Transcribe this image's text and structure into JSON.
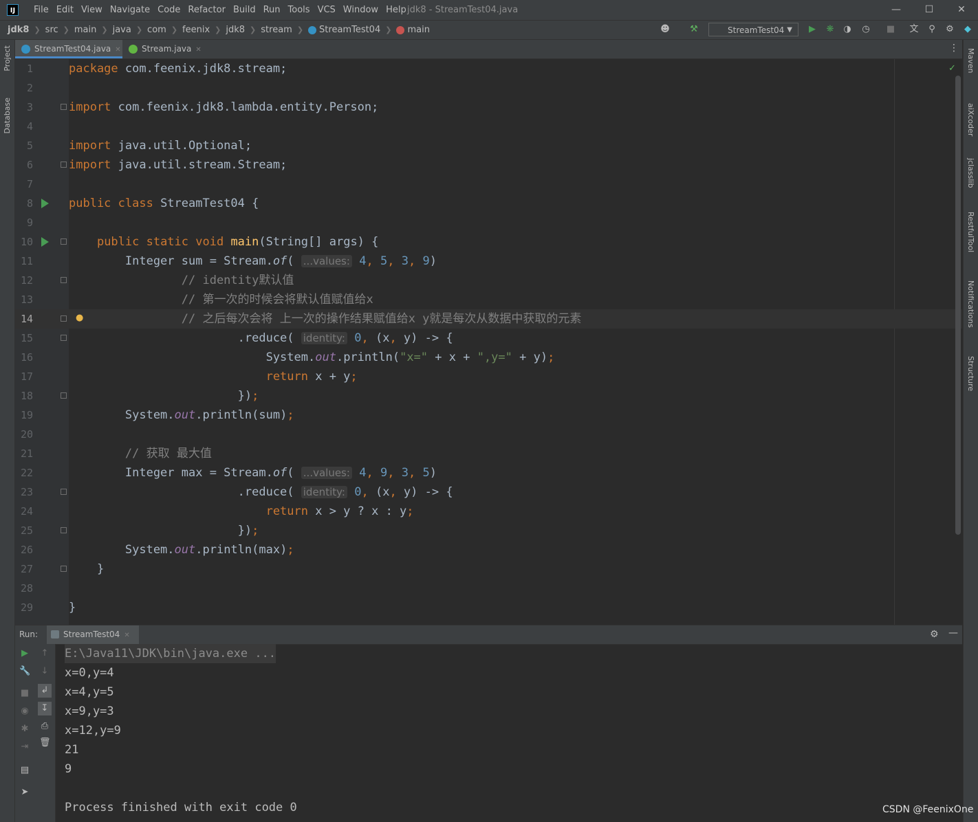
{
  "app": {
    "logo": "IJ",
    "menu": [
      "File",
      "Edit",
      "View",
      "Navigate",
      "Code",
      "Refactor",
      "Build",
      "Run",
      "Tools",
      "VCS",
      "Window",
      "Help"
    ],
    "window_title": "jdk8 - StreamTest04.java",
    "window_controls": [
      "minimize-icon",
      "maximize-icon",
      "close-icon"
    ]
  },
  "breadcrumb": [
    {
      "label": "jdk8",
      "bold": true
    },
    {
      "label": "src"
    },
    {
      "label": "main"
    },
    {
      "label": "java"
    },
    {
      "label": "com"
    },
    {
      "label": "feenix"
    },
    {
      "label": "jdk8"
    },
    {
      "label": "stream"
    },
    {
      "label": "StreamTest04",
      "icon": "class-icon"
    },
    {
      "label": "main",
      "icon": "method-icon"
    }
  ],
  "toolbar": {
    "run_config": "StreamTest04",
    "icons": [
      "user-icon",
      "build-hammer-icon",
      "run-icon",
      "debug-icon",
      "coverage-icon",
      "profile-icon",
      "stop-icon",
      "translate-icon",
      "search-icon",
      "settings-icon",
      "ide-logo-icon"
    ]
  },
  "left_stripe": [
    "Project",
    "Database"
  ],
  "right_stripe": [
    "Maven",
    "aiXcoder",
    "jclasslib",
    "RestfulTool",
    "Notifications",
    "Structure"
  ],
  "tabs": [
    {
      "label": "StreamTest04.java",
      "active": true,
      "icon_color": "#3592c4"
    },
    {
      "label": "Stream.java",
      "active": false,
      "icon_color": "#62b543"
    }
  ],
  "editor": {
    "current_line": 14,
    "lines": [
      {
        "n": "1",
        "html": "<span class=\"kw\">package</span> com.feenix.jdk8.stream;"
      },
      {
        "n": "2",
        "html": ""
      },
      {
        "n": "3",
        "html": "<span class=\"kw\">import</span> com.feenix.jdk8.lambda.entity.Person;",
        "fold": true
      },
      {
        "n": "4",
        "html": ""
      },
      {
        "n": "5",
        "html": "<span class=\"kw\">import</span> java.util.Optional;"
      },
      {
        "n": "6",
        "html": "<span class=\"kw\">import</span> java.util.stream.Stream;",
        "fold": true
      },
      {
        "n": "7",
        "html": ""
      },
      {
        "n": "8",
        "html": "<span class=\"kw\">public class</span> StreamTest04 {",
        "run": true
      },
      {
        "n": "9",
        "html": ""
      },
      {
        "n": "10",
        "html": "    <span class=\"kw\">public static void</span> <span class=\"fn\">main</span>(String[] args) {",
        "run": true,
        "fold": true
      },
      {
        "n": "11",
        "html": "        Integer sum = Stream.<span class=\"ital2\">of</span>( <span class=\"hint\">...values:</span> <span class=\"num\">4</span><span class=\"kw\">,</span> <span class=\"num\">5</span><span class=\"kw\">,</span> <span class=\"num\">3</span><span class=\"kw\">,</span> <span class=\"num\">9</span>)"
      },
      {
        "n": "12",
        "html": "                <span class=\"cmt\">// identity默认值</span>",
        "fold": true
      },
      {
        "n": "13",
        "html": "                <span class=\"cmt\">// 第一次的时候会将默认值赋值给x</span>"
      },
      {
        "n": "14",
        "html": "                <span class=\"cmt\">// 之后每次会将 上一次的操作结果赋值给x y就是每次从数据中获取的元素</span>",
        "fold": true,
        "bulb": true
      },
      {
        "n": "15",
        "html": "                        .reduce( <span class=\"hint\">identity:</span> <span class=\"num\">0</span><span class=\"kw\">,</span> (x<span class=\"kw\">,</span> y) -&gt; {",
        "fold": true
      },
      {
        "n": "16",
        "html": "                            System.<span class=\"ital\">out</span>.println(<span class=\"str\">\"x=\"</span> + x + <span class=\"str\">\",y=\"</span> + y)<span class=\"kw\">;</span>"
      },
      {
        "n": "17",
        "html": "                            <span class=\"kw\">return</span> x + y<span class=\"kw\">;</span>"
      },
      {
        "n": "18",
        "html": "                        })<span class=\"kw\">;</span>",
        "fold": true
      },
      {
        "n": "19",
        "html": "        System.<span class=\"ital\">out</span>.println(sum)<span class=\"kw\">;</span>"
      },
      {
        "n": "20",
        "html": ""
      },
      {
        "n": "21",
        "html": "        <span class=\"cmt\">// 获取 最大值</span>"
      },
      {
        "n": "22",
        "html": "        Integer max = Stream.<span class=\"ital2\">of</span>( <span class=\"hint\">...values:</span> <span class=\"num\">4</span><span class=\"kw\">,</span> <span class=\"num\">9</span><span class=\"kw\">,</span> <span class=\"num\">3</span><span class=\"kw\">,</span> <span class=\"num\">5</span>)"
      },
      {
        "n": "23",
        "html": "                        .reduce( <span class=\"hint\">identity:</span> <span class=\"num\">0</span><span class=\"kw\">,</span> (x<span class=\"kw\">,</span> y) -&gt; {",
        "fold": true
      },
      {
        "n": "24",
        "html": "                            <span class=\"kw\">return</span> x &gt; y ? x : y<span class=\"kw\">;</span>"
      },
      {
        "n": "25",
        "html": "                        })<span class=\"kw\">;</span>",
        "fold": true
      },
      {
        "n": "26",
        "html": "        System.<span class=\"ital\">out</span>.println(max)<span class=\"kw\">;</span>"
      },
      {
        "n": "27",
        "html": "    }",
        "fold": true
      },
      {
        "n": "28",
        "html": ""
      },
      {
        "n": "29",
        "html": "}"
      }
    ]
  },
  "run_panel": {
    "label": "Run:",
    "tab": "StreamTest04",
    "output": [
      "E:\\Java11\\JDK\\bin\\java.exe ...",
      "x=0,y=4",
      "x=4,y=5",
      "x=9,y=3",
      "x=12,y=9",
      "21",
      "9",
      "",
      "Process finished with exit code 0"
    ]
  },
  "watermark": "CSDN @FeenixOne"
}
